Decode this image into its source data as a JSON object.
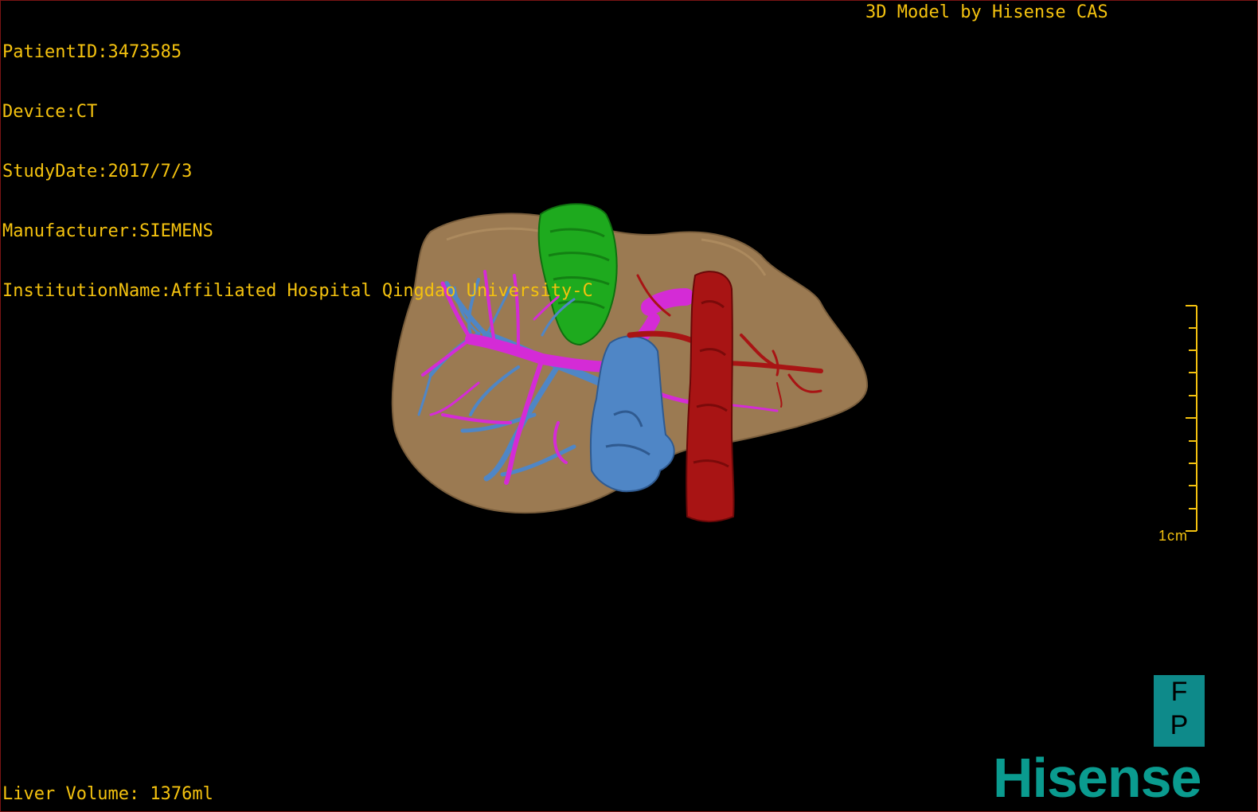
{
  "header": {
    "patient_id": "PatientID:3473585",
    "device": "Device:CT",
    "study_date": "StudyDate:2017/7/3",
    "manufacturer": "Manufacturer:SIEMENS",
    "institution": "InstitutionName:Affiliated Hospital Qingdao University-C"
  },
  "brand_title": "3D Model by Hisense CAS",
  "footer": {
    "liver_volume": "Liver Volume: 1376ml"
  },
  "scale_bar": {
    "label": "1cm"
  },
  "orientation": {
    "line1": "F",
    "line2": "P"
  },
  "logo": {
    "text": "Hisense"
  },
  "colors": {
    "overlay_text": "#f4c20f",
    "liver": "#9b7a52",
    "portal_vein": "#d42bd6",
    "hepatic_vein": "#4f86c6",
    "gallbladder": "#1eaa1e",
    "aorta": "#a81414",
    "brand": "#0a9b8f"
  }
}
